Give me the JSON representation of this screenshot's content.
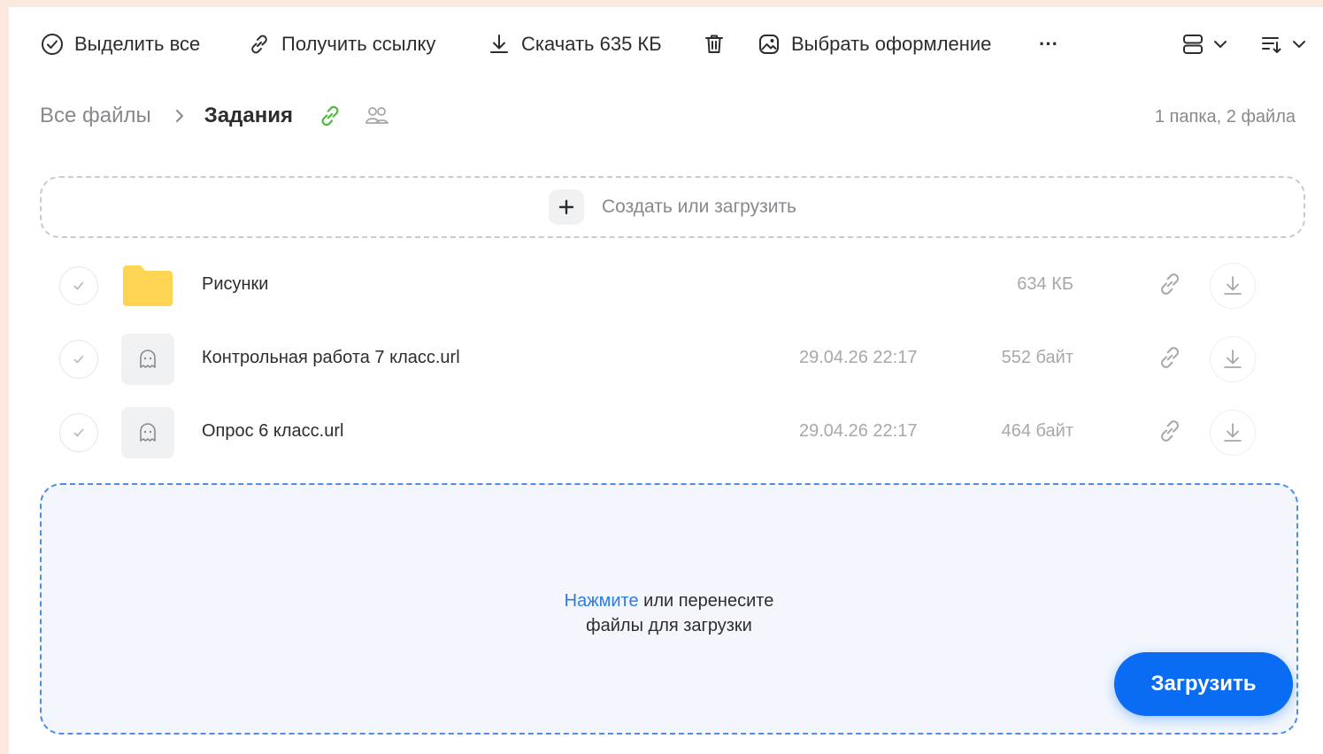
{
  "toolbar": {
    "select_all": "Выделить все",
    "get_link": "Получить ссылку",
    "download": "Скачать 635 КБ",
    "choose_theme": "Выбрать оформление",
    "more": "···"
  },
  "breadcrumb": {
    "root": "Все файлы",
    "current": "Задания"
  },
  "counts": "1 папка, 2 файла",
  "create_upload": "Создать или загрузить",
  "files": [
    {
      "name": "Рисунки",
      "date": "",
      "size": "634 КБ",
      "kind": "folder"
    },
    {
      "name": "Контрольная работа 7 класс.url",
      "date": "29.04.26 22:17",
      "size": "552 байт",
      "kind": "file"
    },
    {
      "name": "Опрос 6 класс.url",
      "date": "29.04.26 22:17",
      "size": "464 байт",
      "kind": "file"
    }
  ],
  "dropzone": {
    "link": "Нажмите",
    "text_rest": " или перенесите",
    "line2": "файлы для загрузки"
  },
  "upload_button": "Загрузить",
  "colors": {
    "accent": "#0a6cf2",
    "link": "#2f7ae5",
    "folder": "#ffd452",
    "share_link_green": "#4fb83c",
    "background": "#fbe9df"
  },
  "icons": {
    "select_all": "check-circle-icon",
    "get_link": "link-icon",
    "download": "download-icon",
    "delete": "trash-icon",
    "theme": "image-icon",
    "view": "list-view-icon",
    "sort": "sort-icon"
  }
}
